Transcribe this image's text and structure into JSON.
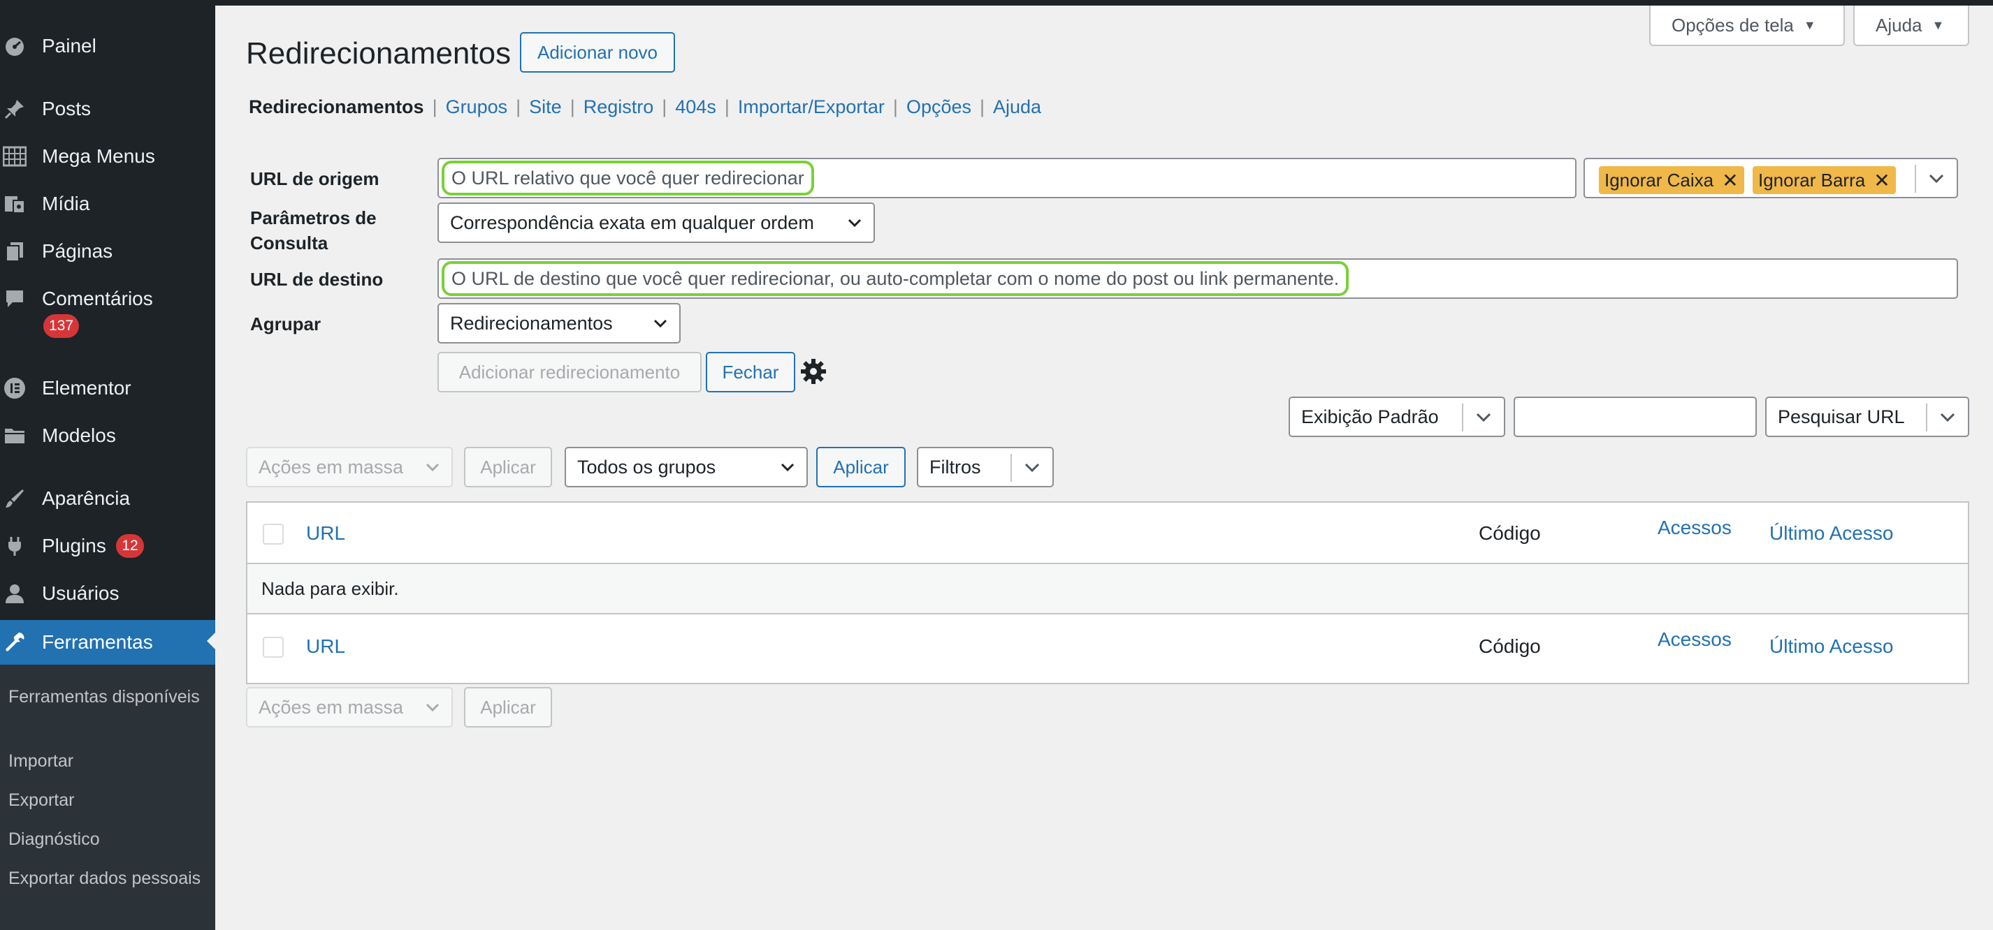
{
  "sidebar": {
    "items": [
      {
        "label": "Painel",
        "icon": "dashboard-icon"
      },
      {
        "label": "Posts",
        "icon": "pin-icon"
      },
      {
        "label": "Mega Menus",
        "icon": "grid-icon"
      },
      {
        "label": "Mídia",
        "icon": "media-icon"
      },
      {
        "label": "Páginas",
        "icon": "pages-icon"
      },
      {
        "label": "Comentários",
        "icon": "comment-icon",
        "badge": "137"
      },
      {
        "label": "Elementor",
        "icon": "elementor-icon"
      },
      {
        "label": "Modelos",
        "icon": "folder-icon"
      },
      {
        "label": "Aparência",
        "icon": "brush-icon"
      },
      {
        "label": "Plugins",
        "icon": "plugin-icon",
        "badge": "12"
      },
      {
        "label": "Usuários",
        "icon": "user-icon"
      },
      {
        "label": "Ferramentas",
        "icon": "wrench-icon"
      }
    ],
    "submenu": [
      "Ferramentas disponíveis",
      "Importar",
      "Exportar",
      "Diagnóstico",
      "Exportar dados pessoais"
    ]
  },
  "header": {
    "screen_options": "Opções de tela",
    "help": "Ajuda",
    "title": "Redirecionamentos",
    "add_new": "Adicionar novo"
  },
  "subnav": {
    "current": "Redirecionamentos",
    "links": [
      "Grupos",
      "Site",
      "Registro",
      "404s",
      "Importar/Exportar",
      "Opções",
      "Ajuda"
    ],
    "separator": "|"
  },
  "form": {
    "source_label": "URL de origem",
    "source_placeholder": "O URL relativo que você quer redirecionar",
    "tags": [
      "Ignorar Caixa",
      "Ignorar Barra"
    ],
    "query_label": "Parâmetros de Consulta",
    "query_value": "Correspondência exata em qualquer ordem",
    "target_label": "URL de destino",
    "target_placeholder": "O URL de destino que você quer redirecionar, ou auto-completar com o nome do post ou link permanente.",
    "group_label": "Agrupar",
    "group_value": "Redirecionamentos",
    "add_button": "Adicionar redirecionamento",
    "close_button": "Fechar"
  },
  "toolbar": {
    "view_select": "Exibição Padrão",
    "search_select": "Pesquisar URL",
    "bulk_actions": "Ações em massa",
    "apply": "Aplicar",
    "groups_select": "Todos os grupos",
    "filters": "Filtros"
  },
  "table": {
    "columns": [
      "URL",
      "Código",
      "Acessos",
      "Último Acesso"
    ],
    "empty_message": "Nada para exibir."
  },
  "colors": {
    "sidebar_bg": "#1d2327",
    "accent": "#2271b1",
    "badge": "#d63638",
    "tag": "#f0b849",
    "highlight": "#7ad03a"
  }
}
